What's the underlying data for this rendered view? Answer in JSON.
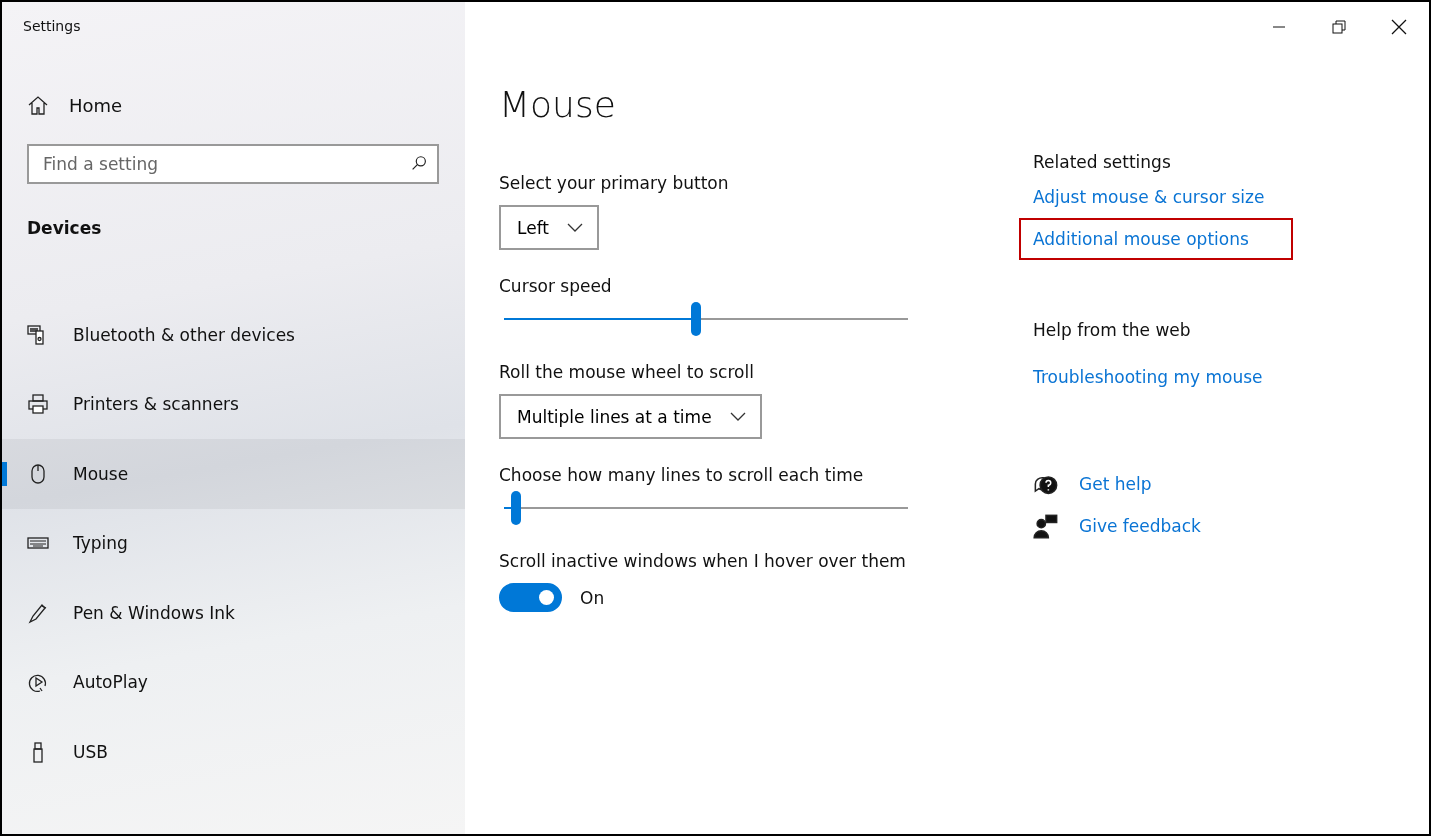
{
  "window": {
    "title": "Settings"
  },
  "sidebar": {
    "home": "Home",
    "search": {
      "placeholder": "Find a setting"
    },
    "section": "Devices",
    "items": [
      {
        "label": "Bluetooth & other devices",
        "selected": false
      },
      {
        "label": "Printers & scanners",
        "selected": false
      },
      {
        "label": "Mouse",
        "selected": true
      },
      {
        "label": "Typing",
        "selected": false
      },
      {
        "label": "Pen & Windows Ink",
        "selected": false
      },
      {
        "label": "AutoPlay",
        "selected": false
      },
      {
        "label": "USB",
        "selected": false
      }
    ]
  },
  "page": {
    "title": "Mouse",
    "settings": [
      {
        "kind": "dropdown",
        "label": "Select your primary button",
        "value": "Left"
      },
      {
        "kind": "slider",
        "label": "Cursor speed",
        "level": 0.475
      },
      {
        "kind": "dropdown",
        "label": "Roll the mouse wheel to scroll",
        "value": "Multiple lines at a time"
      },
      {
        "kind": "slider",
        "label": "Choose how many lines to scroll each time",
        "level": 0.03
      },
      {
        "kind": "toggle",
        "label": "Scroll inactive windows when I hover over them",
        "on": true,
        "state": "On"
      }
    ]
  },
  "related": {
    "title": "Related settings",
    "links": [
      {
        "label": "Adjust mouse & cursor size",
        "highlighted": false
      },
      {
        "label": "Additional mouse options",
        "highlighted": true
      }
    ]
  },
  "help": {
    "title": "Help from the web",
    "links": [
      "Troubleshooting my mouse"
    ]
  },
  "actions": [
    {
      "kind": "help",
      "label": "Get help"
    },
    {
      "kind": "feedback",
      "label": "Give feedback"
    }
  ]
}
